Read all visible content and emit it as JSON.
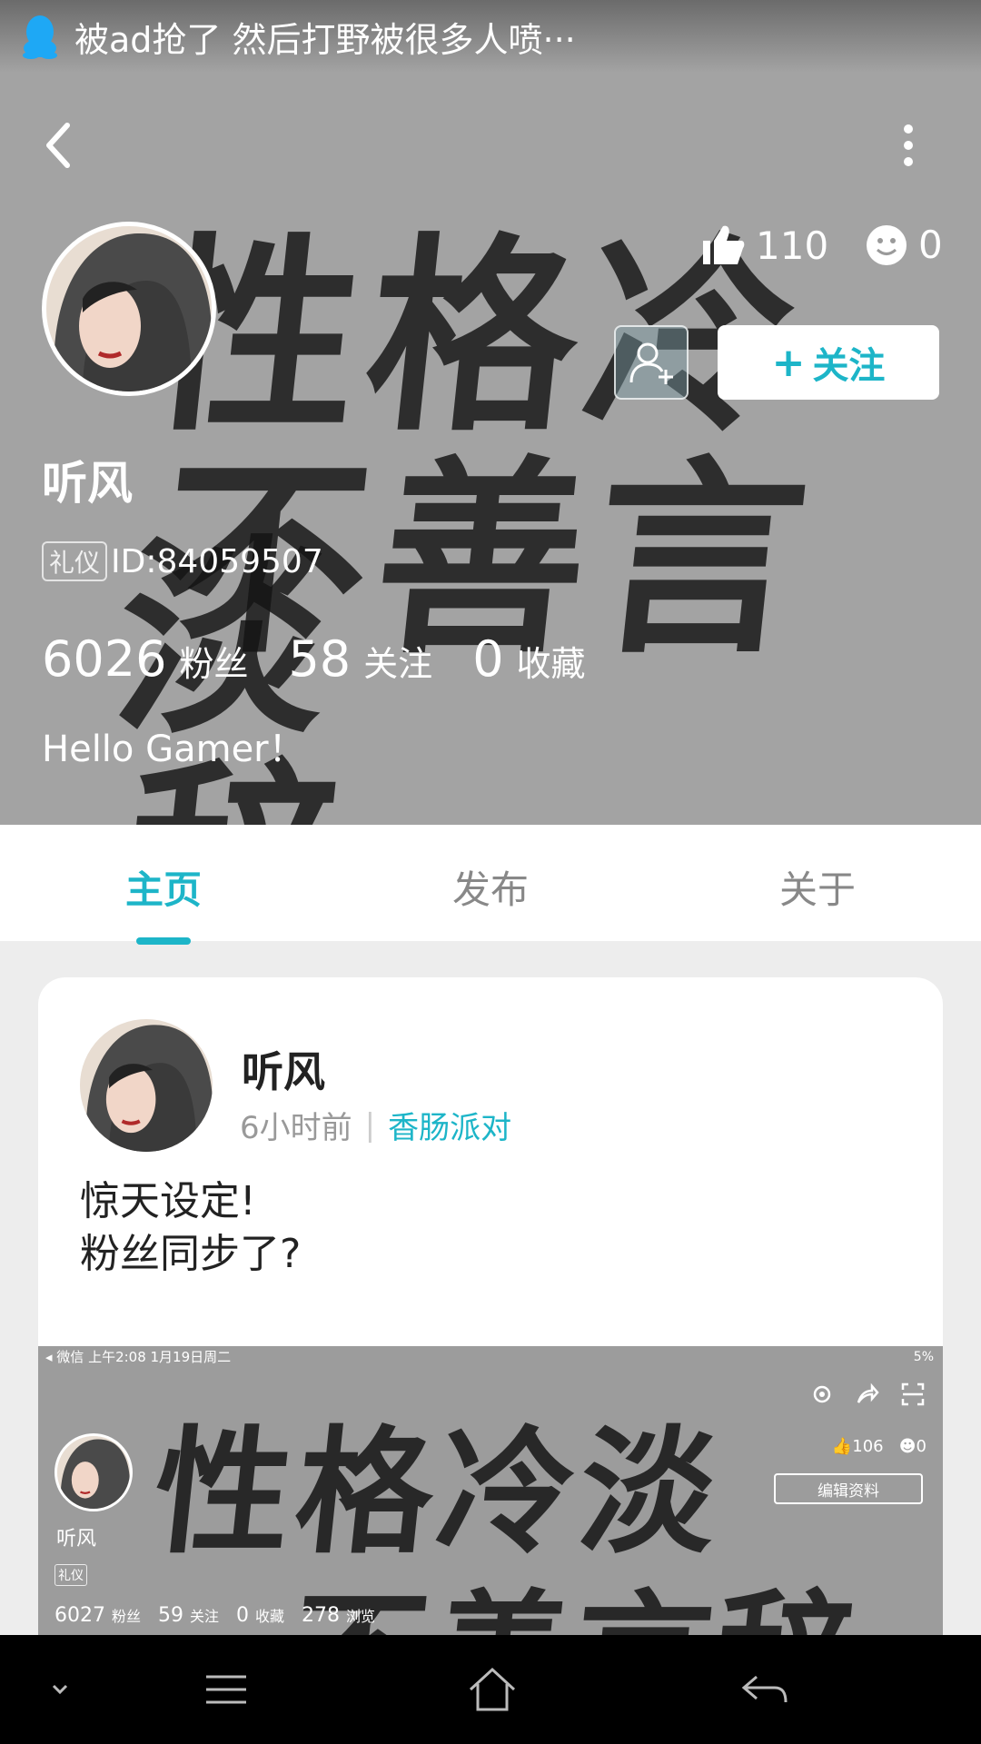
{
  "notification": {
    "text": "被ad抢了 然后打野被很多人喷···"
  },
  "header": {
    "background_text": [
      "性格冷淡",
      "不善言辞"
    ],
    "likes": "110",
    "emoji_count": "0",
    "follow_label": "关注",
    "username": "听风",
    "badge": "礼仪",
    "id": "ID:84059507",
    "counts": [
      {
        "value": "6026",
        "label": "粉丝"
      },
      {
        "value": "58",
        "label": "关注"
      },
      {
        "value": "0",
        "label": "收藏"
      }
    ],
    "bio": "Hello Gamer！"
  },
  "tabs": [
    {
      "label": "主页",
      "active": true
    },
    {
      "label": "发布",
      "active": false
    },
    {
      "label": "关于",
      "active": false
    }
  ],
  "post": {
    "author": "听风",
    "time": "6小时前",
    "topic": "香肠派对",
    "lines": [
      "惊天设定!",
      "粉丝同步了?"
    ],
    "image": {
      "status_left": "◂ 微信  上午2:08  1月19日周二",
      "status_right": "5%",
      "background_text": [
        "性格冷淡",
        "不善言辞"
      ],
      "likes": "106",
      "emoji_count": "0",
      "edit_label": "编辑资料",
      "name": "听风",
      "badge": "礼仪",
      "stats": [
        {
          "value": "6027",
          "label": "粉丝"
        },
        {
          "value": "59",
          "label": "关注"
        },
        {
          "value": "0",
          "label": "收藏"
        },
        {
          "value": "278",
          "label": "浏览"
        }
      ]
    }
  },
  "colors": {
    "accent": "#1db5c8",
    "qq_icon": "#1ea8f5"
  },
  "icons": {
    "notification": "qq-icon",
    "back": "back-arrow-icon",
    "more": "more-vertical-icon",
    "like": "thumbs-up-icon",
    "emoji": "smile-icon",
    "add_friend": "add-friend-icon",
    "nav": [
      "chevron-down-icon",
      "menu-icon",
      "home-icon",
      "back-icon"
    ]
  }
}
